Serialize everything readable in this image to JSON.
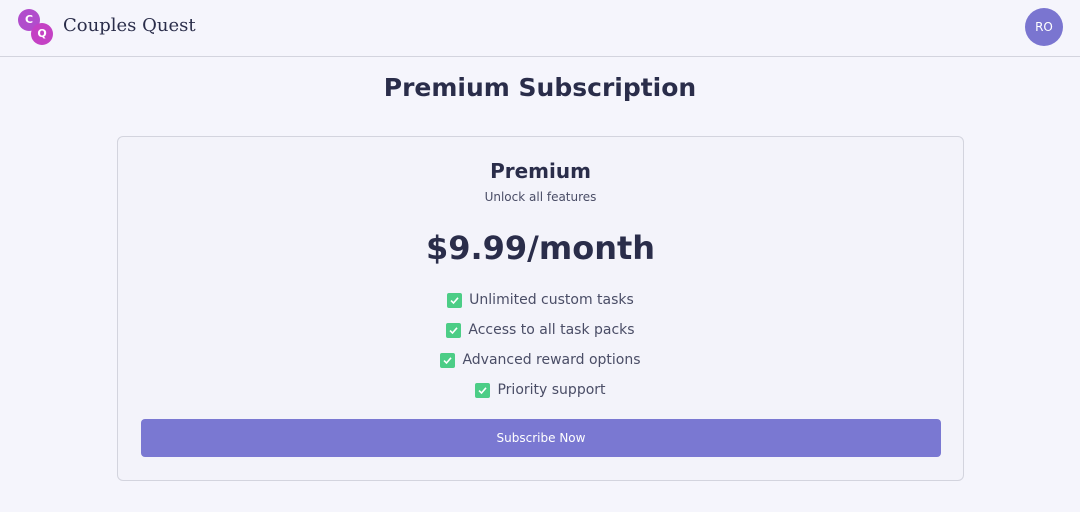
{
  "header": {
    "logo_letters": [
      "C",
      "Q"
    ],
    "brand": "Couples Quest",
    "avatar_initials": "RO"
  },
  "main": {
    "title": "Premium Subscription",
    "plan": {
      "name": "Premium",
      "tagline": "Unlock all features",
      "price": "$9.99/month",
      "features": [
        "Unlimited custom tasks",
        "Access to all task packs",
        "Advanced reward options",
        "Priority support"
      ],
      "cta_label": "Subscribe Now"
    }
  },
  "colors": {
    "accent": "#7a78d2",
    "check": "#4ccd86",
    "logo": "#c441c4"
  },
  "icons": {
    "feature_check": "check-icon",
    "logo": "couples-quest-logo"
  }
}
